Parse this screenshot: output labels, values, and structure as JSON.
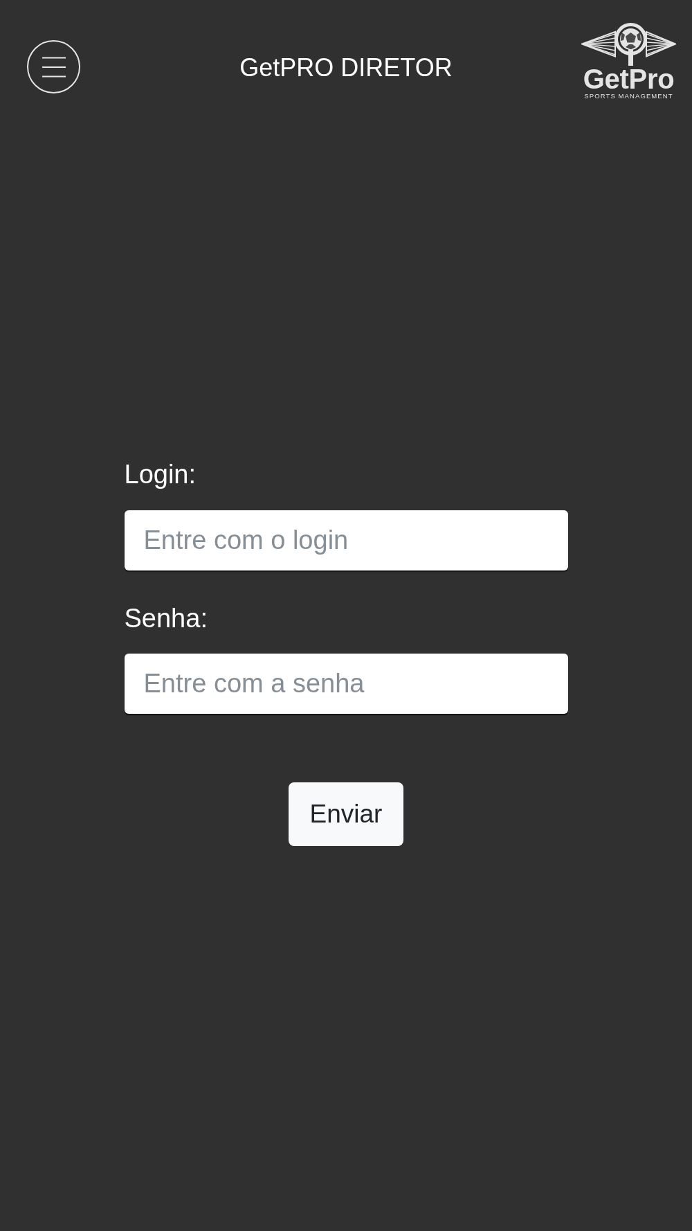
{
  "header": {
    "title": "GetPRO DIRETOR",
    "logo": {
      "name": "GetPro",
      "tagline": "SPORTS MANAGEMENT"
    }
  },
  "form": {
    "fields": [
      {
        "label": "Login:",
        "placeholder": "Entre com o login"
      },
      {
        "label": "Senha:",
        "placeholder": "Entre com a senha"
      }
    ],
    "submit": "Enviar"
  }
}
